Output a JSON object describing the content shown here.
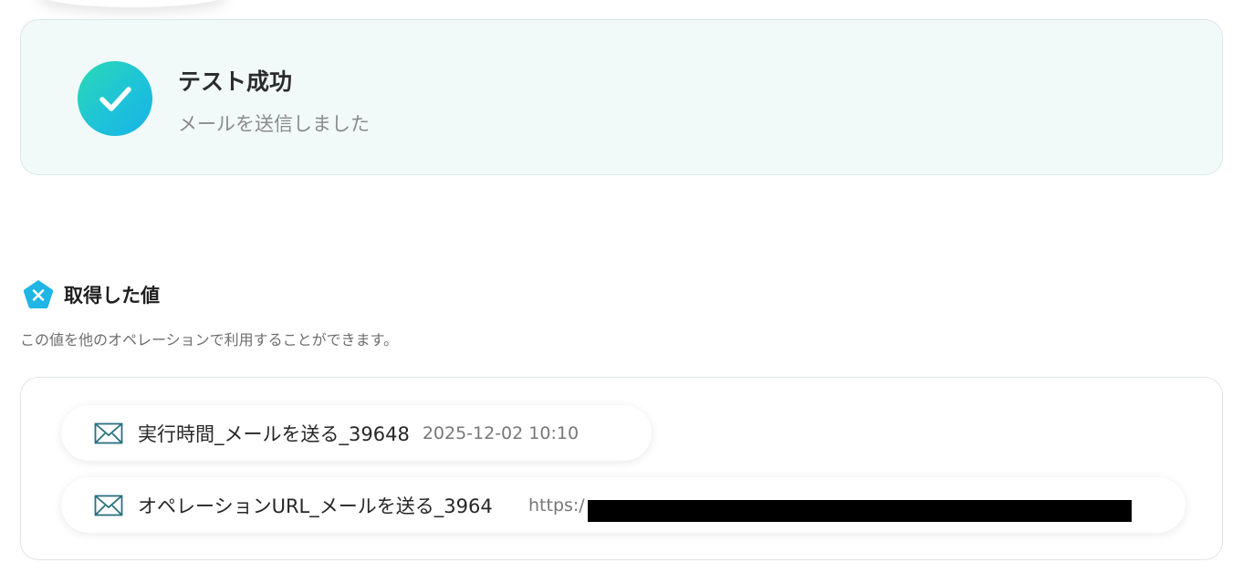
{
  "success": {
    "title": "テスト成功",
    "message": "メールを送信しました",
    "accent_color": "#1ec3d8"
  },
  "values_section": {
    "title": "取得した値",
    "description": "この値を他のオペレーションで利用することができます。",
    "icon": "x-pentagon-icon",
    "items": [
      {
        "icon": "mail-icon",
        "label": "実行時間_メールを送る_39648",
        "value": "2025-12-02 10:10"
      },
      {
        "icon": "mail-icon",
        "label": "オペレーションURL_メールを送る_3964",
        "value": "https:/"
      }
    ]
  }
}
